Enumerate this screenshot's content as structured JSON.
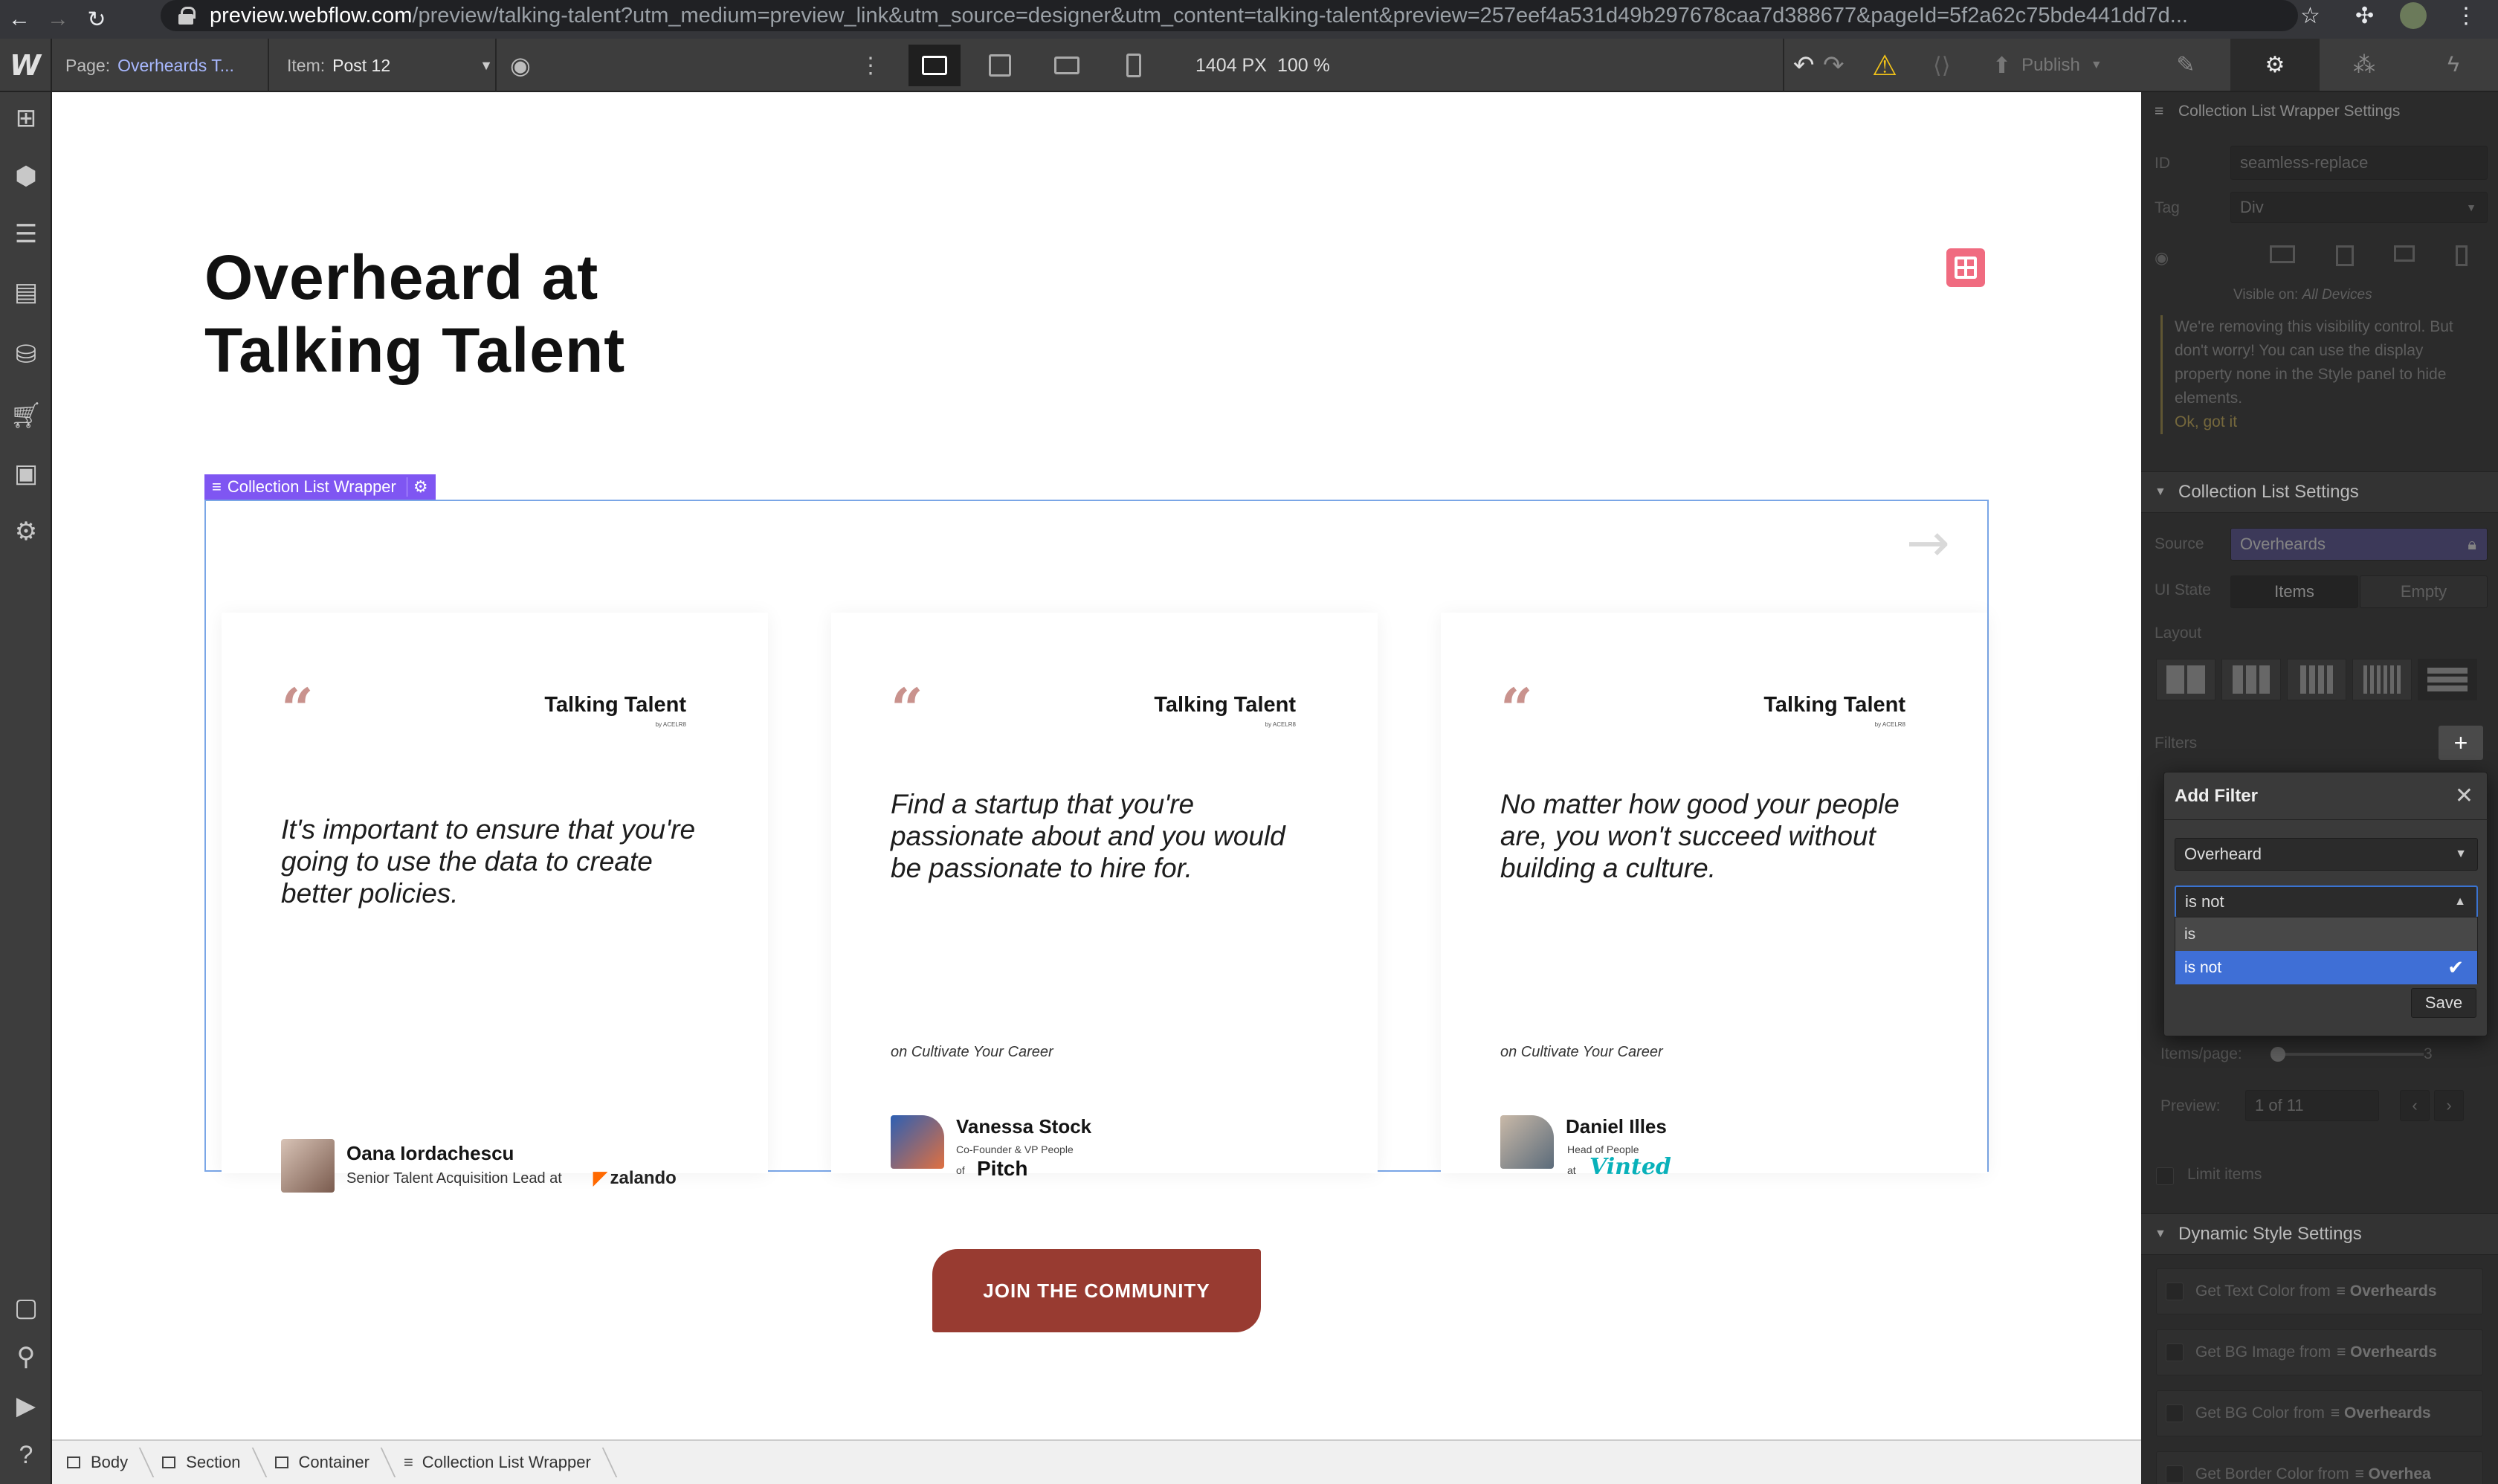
{
  "browser": {
    "url_host": "preview.webflow.com",
    "url_path": "/preview/talking-talent?utm_medium=preview_link&utm_source=designer&utm_content=talking-talent&preview=257eef4a531d49b297678caa7d388677&pageId=5f2a62c75bde441dd7d..."
  },
  "topbar": {
    "page_label": "Page:",
    "page_value": "Overheards T...",
    "item_label": "Item:",
    "item_value": "Post 12",
    "width_px": "1404 PX",
    "zoom": "100 %",
    "publish_label": "Publish"
  },
  "canvas": {
    "title": "Overheard at\nTalking Talent",
    "collection_label": "Collection List Wrapper",
    "cta_label": "JOIN THE COMMUNITY",
    "cards": [
      {
        "brand": "Talking Talent",
        "brand_sub": "by ACELR8",
        "quote": "It's important to ensure that you're going to use the data to create better policies.",
        "source": "",
        "person": "Oana Iordachescu",
        "role": "Senior Talent Acquisition Lead at",
        "company": "zalando"
      },
      {
        "brand": "Talking Talent",
        "brand_sub": "by ACELR8",
        "quote": "Find a startup that you're passionate about and you would be passionate to hire for.",
        "source": "on Cultivate Your Career",
        "person": "Vanessa Stock",
        "role": "Co-Founder & VP People",
        "role_prefix": "of",
        "company": "Pitch"
      },
      {
        "brand": "Talking Talent",
        "brand_sub": "by ACELR8",
        "quote": "No matter how good your people are, you won't succeed without building a culture.",
        "source": "on Cultivate Your Career",
        "person": "Daniel Illes",
        "role": "Head of People",
        "role_prefix": "at",
        "company": "Vinted"
      }
    ]
  },
  "breadcrumb": [
    "Body",
    "Section",
    "Container",
    "Collection List Wrapper"
  ],
  "panel": {
    "header": "Collection List Wrapper Settings",
    "id_label": "ID",
    "id_value": "seamless-replace",
    "tag_label": "Tag",
    "tag_value": "Div",
    "visible_on_label": "Visible on:",
    "visible_on_value": "All Devices",
    "notice": "We're removing this visibility control. But don't worry! You can use the display property none in the Style panel to hide elements.",
    "notice_ok": "Ok, got it",
    "cl_settings_title": "Collection List Settings",
    "source_label": "Source",
    "source_value": "Overheards",
    "ui_state_label": "UI State",
    "ui_state_items": "Items",
    "ui_state_empty": "Empty",
    "layout_label": "Layout",
    "filters_label": "Filters",
    "items_page_label": "Items/page:",
    "items_page_value": "3",
    "preview_label": "Preview:",
    "preview_value": "1 of 11",
    "limit_items": "Limit items",
    "dynamic_title": "Dynamic Style Settings",
    "dyn_buttons": [
      {
        "text": "Get Text Color from",
        "src": "Overheards"
      },
      {
        "text": "Get BG Image from",
        "src": "Overheards"
      },
      {
        "text": "Get BG Color from",
        "src": "Overheards"
      },
      {
        "text": "Get Border Color from",
        "src": "Overhea"
      }
    ]
  },
  "filter_popup": {
    "title": "Add Filter",
    "field_value": "Overheard",
    "condition_value": "is not",
    "options": [
      "is",
      "is not"
    ],
    "save_label": "Save"
  },
  "colors": {
    "accent_purple": "#7f56f2",
    "cta_red": "#983b31",
    "quote_mark": "#c9928d",
    "select_blue": "#3f6fd6"
  }
}
